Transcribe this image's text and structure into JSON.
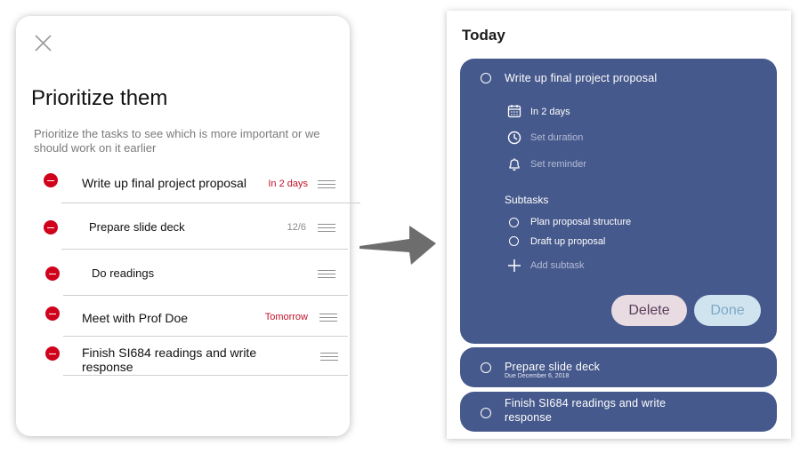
{
  "prioritize": {
    "title": "Prioritize them",
    "subtitle": "Prioritize the tasks to see which is more important or we should work on it earlier",
    "tasks": [
      {
        "label": "Write up final project proposal",
        "due": "In 2 days",
        "count": ""
      },
      {
        "label": "Prepare slide deck",
        "due": "",
        "count": "12/6"
      },
      {
        "label": "Do readings",
        "due": "",
        "count": ""
      },
      {
        "label": "Meet with Prof Doe",
        "due": "Tomorrow",
        "count": ""
      },
      {
        "label": "Finish SI684 readings and write response",
        "due": "",
        "count": ""
      }
    ]
  },
  "today": {
    "title": "Today",
    "expanded_task": {
      "title": "Write up final project proposal",
      "due": "In 2 days",
      "duration_placeholder": "Set duration",
      "reminder_placeholder": "Set reminder",
      "subtasks_heading": "Subtasks",
      "subtasks": [
        "Plan proposal structure",
        "Draft up proposal"
      ],
      "add_subtask": "Add subtask",
      "delete_label": "Delete",
      "done_label": "Done"
    },
    "tasks": [
      {
        "title": "Prepare slide deck",
        "due": "Due December 6, 2018"
      },
      {
        "title": "Finish SI684 readings and write response",
        "due": ""
      }
    ]
  },
  "colors": {
    "card_bg": "#46598c",
    "delete_red": "#d0021b",
    "due_red": "#c0122a",
    "delete_button_bg": "#e8dbe2",
    "done_button_bg": "#cfe4ef"
  },
  "icons": [
    "close-icon",
    "minus-circle-icon",
    "drag-handle-icon",
    "arrow-right-icon",
    "circle-checkbox-icon",
    "calendar-icon",
    "clock-icon",
    "bell-icon",
    "plus-icon"
  ]
}
